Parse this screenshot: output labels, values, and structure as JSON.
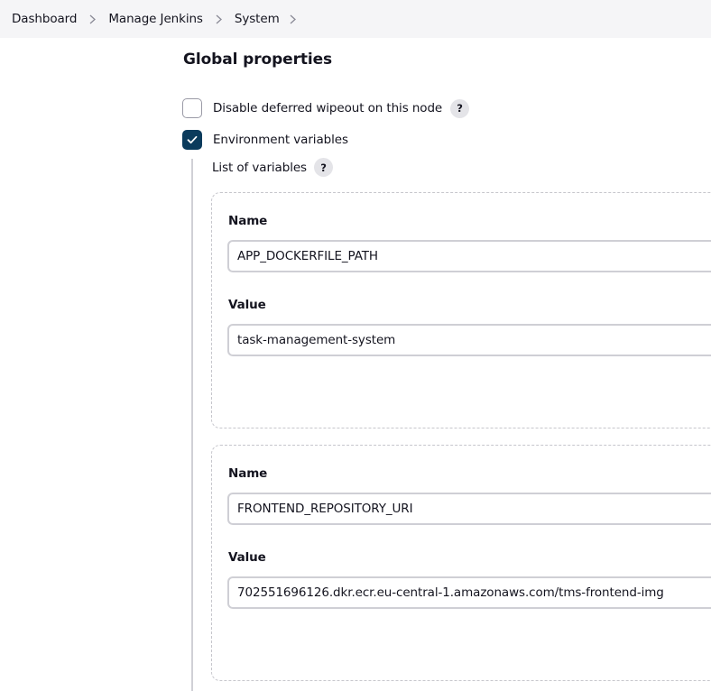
{
  "breadcrumb": {
    "items": [
      "Dashboard",
      "Manage Jenkins",
      "System"
    ]
  },
  "section": {
    "title": "Global properties"
  },
  "options": {
    "deferred_wipeout": {
      "label": "Disable deferred wipeout on this node",
      "checked": false,
      "help": "?"
    },
    "environment_variables": {
      "label": "Environment variables",
      "checked": true
    }
  },
  "variables": {
    "list_label": "List of variables",
    "help": "?",
    "name_label": "Name",
    "value_label": "Value",
    "items": [
      {
        "name": "APP_DOCKERFILE_PATH",
        "value": "task-management-system"
      },
      {
        "name": "FRONTEND_REPOSITORY_URI",
        "value": "702551696126.dkr.ecr.eu-central-1.amazonaws.com/tms-frontend-img"
      }
    ]
  },
  "colors": {
    "checkbox_checked": "#0b3b5c",
    "breadcrumb_bg": "#f5f5f7"
  },
  "icons": {
    "separator": "chevron-right-icon",
    "check": "checkmark-icon",
    "help": "question-mark-icon"
  }
}
